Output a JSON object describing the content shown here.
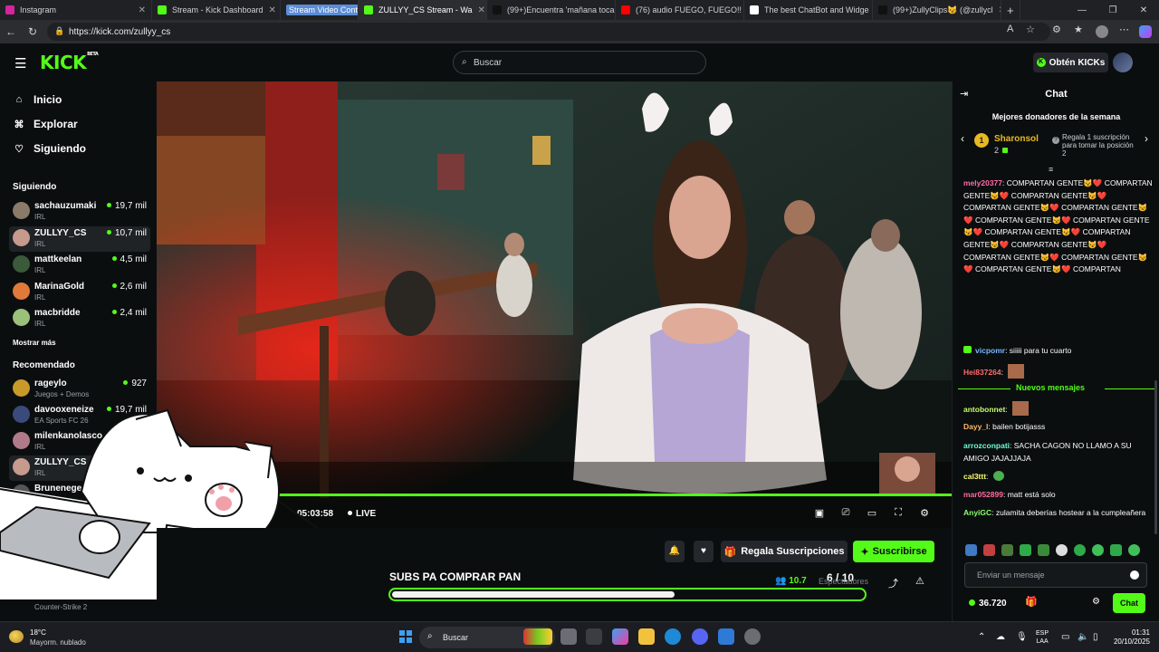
{
  "browser": {
    "tabs": [
      {
        "label": "Instagram",
        "color": "#d6249f"
      },
      {
        "label": "Stream - Kick Dashboard",
        "color": "#53fc18"
      },
      {
        "label": "Stream Video Content",
        "color": "",
        "highlighted": true
      },
      {
        "label": "ZULLYY_CS Stream - Wa",
        "color": "#53fc18",
        "active": true
      },
      {
        "label": "(99+)Encuentra 'mañana toca",
        "color": "#111111"
      },
      {
        "label": "(76) audio FUEGO, FUEGO!! C",
        "color": "#ff0000"
      },
      {
        "label": "The best ChatBot and Widge",
        "color": "#ffffff"
      },
      {
        "label": "(99+)ZullyClips😼 (@zullycl",
        "color": "#111111"
      }
    ],
    "url": "https://kick.com/zullyy_cs"
  },
  "header": {
    "logo": "KICK",
    "logo_badge": "BETA",
    "search_placeholder": "Buscar",
    "get_kicks_label": "Obtén KICKs"
  },
  "sidebar": {
    "nav": [
      {
        "label": "Inicio",
        "icon": "home-icon"
      },
      {
        "label": "Explorar",
        "icon": "compass-icon"
      },
      {
        "label": "Siguiendo",
        "icon": "heart-icon"
      }
    ],
    "following_title": "Siguiendo",
    "following": [
      {
        "name": "sachauzumaki",
        "category": "IRL",
        "viewers": "19,7 mil",
        "avatar": "#8a7a6a"
      },
      {
        "name": "ZULLYY_CS",
        "category": "IRL",
        "viewers": "10,7 mil",
        "avatar": "#c79a8e",
        "selected": true
      },
      {
        "name": "mattkeelan",
        "category": "IRL",
        "viewers": "4,5 mil",
        "avatar": "#3a5a3a"
      },
      {
        "name": "MarinaGold",
        "category": "IRL",
        "viewers": "2,6 mil",
        "avatar": "#e07a3a"
      },
      {
        "name": "macbridde",
        "category": "IRL",
        "viewers": "2,4 mil",
        "avatar": "#9ac07a"
      }
    ],
    "show_more": "Mostrar más",
    "recommended_title": "Recomendado",
    "recommended": [
      {
        "name": "rageylo",
        "category": "Juegos + Demos",
        "viewers": "927",
        "avatar": "#c89a2a"
      },
      {
        "name": "davooxeneize",
        "category": "EA Sports FC 26",
        "viewers": "19,7 mil",
        "avatar": "#3a4a7a"
      },
      {
        "name": "milenkanolasco",
        "category": "IRL",
        "viewers": "",
        "avatar": "#b07a8a"
      },
      {
        "name": "ZULLYY_CS",
        "category": "IRL",
        "viewers": "",
        "avatar": "#c79a8e",
        "selected": true
      },
      {
        "name": "Bruneneger",
        "category": "",
        "viewers": "",
        "avatar": "#555555"
      }
    ],
    "partial_category": "Counter-Strike 2"
  },
  "video": {
    "time": "05:03:58",
    "live_label": "LIVE",
    "live_progress": 1.0
  },
  "stream": {
    "title": "SUBS PA COMPRAR PAN",
    "goal_current": "6",
    "goal_sep": "/",
    "goal_total": "10",
    "goal_fraction": 0.6,
    "viewers": "10.7",
    "viewers_label": "Espectadores",
    "gift_subs_label": "Regala Suscripciones",
    "subscribe_label": "Suscribirse"
  },
  "chat": {
    "title": "Chat",
    "top_donors_title": "Mejores donadores de la semana",
    "donor_rank": "1",
    "donor_name": "Sharonsol",
    "donor_count": "2",
    "donor_gift_text": "Regala 1 suscripción para tomar la posición 2",
    "messages_top": [
      {
        "user": "mely20377",
        "color": "#ff6ba8",
        "text": ": COMPARTAN GENTE😼❤️ COMPARTAN GENTE😼❤️ COMPARTAN GENTE😼❤️ COMPARTAN GENTE😼❤️ COMPARTAN GENTE😼❤️ COMPARTAN GENTE😼❤️ COMPARTAN GENTE😼❤️ COMPARTAN GENTE😼❤️ COMPARTAN GENTE😼❤️ COMPARTAN GENTE😼❤️ COMPARTAN GENTE😼❤️ COMPARTAN GENTE😼❤️ COMPARTAN GENTE😼❤️ COMPARTAN"
      },
      {
        "user": "vicpomr",
        "color": "#7ab8ff",
        "text": ": siiiii para tu cuarto"
      },
      {
        "user": "Hei837264",
        "color": "#ff6b6b",
        "text": ":"
      }
    ],
    "new_messages_label": "Nuevos mensajes",
    "messages_bottom": [
      {
        "user": "antobonnet",
        "color": "#c7ff6b",
        "text": ":"
      },
      {
        "user": "Dayy_l",
        "color": "#ffb86b",
        "text": ": bailen botijasss"
      },
      {
        "user": "arrozconpati",
        "color": "#6bffd2",
        "text": ": SACHA CAGON NO LLAMO A SU AMIGO JAJAJJAJA"
      },
      {
        "user": "cal3ttt",
        "color": "#f6ff6b",
        "text": ":"
      },
      {
        "user": "mar052899",
        "color": "#ff6b9d",
        "text": ": matt está solo"
      },
      {
        "user": "AnyiGC",
        "color": "#8cff6b",
        "text": ": zulamita deberías hostear a la cumpleañera"
      }
    ],
    "input_placeholder": "Enviar un mensaje",
    "kicks_balance": "36.720",
    "send_label": "Chat"
  },
  "taskbar": {
    "temperature": "18°C",
    "weather": "Mayorm. nublado",
    "search_label": "Buscar",
    "lang_1": "ESP",
    "lang_2": "LAA",
    "time": "01:31",
    "date": "20/10/2025"
  }
}
